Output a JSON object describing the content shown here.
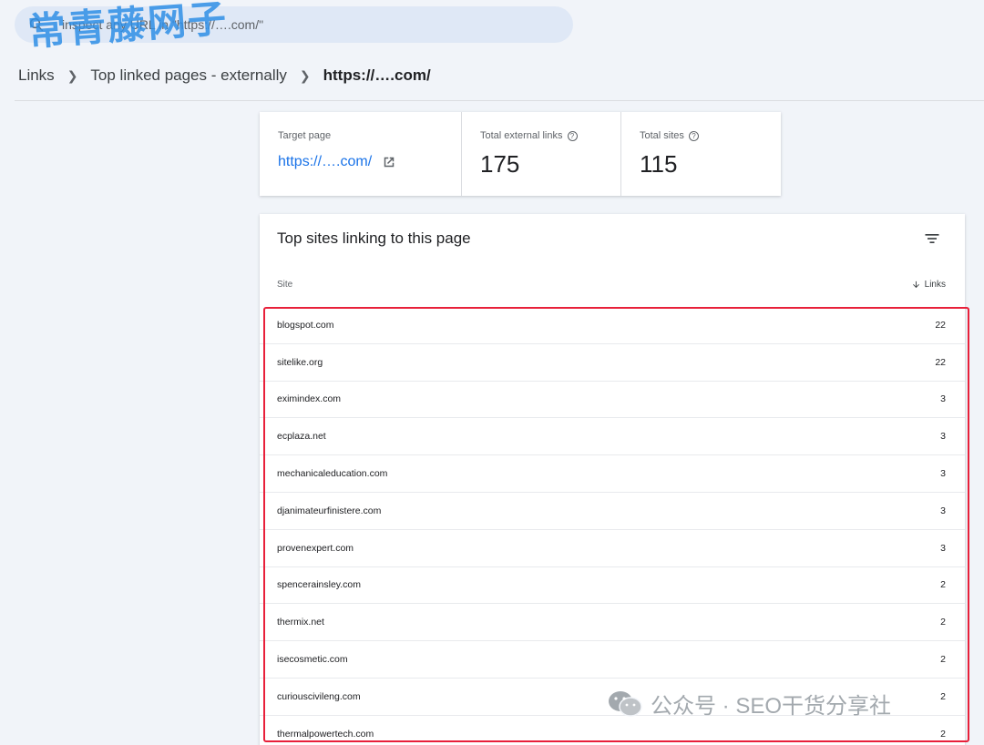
{
  "search": {
    "value": "inspect any URL in \"https://….com/\""
  },
  "watermark_top": "常青藤网子",
  "breadcrumb": {
    "items": [
      "Links",
      "Top linked pages - externally"
    ],
    "current": "https://….com/"
  },
  "stats": {
    "target": {
      "label": "Target page",
      "value": "https://….com/"
    },
    "external_links": {
      "label": "Total external links",
      "value": "175"
    },
    "sites": {
      "label": "Total sites",
      "value": "115"
    }
  },
  "table": {
    "title": "Top sites linking to this page",
    "col_site": "Site",
    "col_links": "Links",
    "rows": [
      {
        "site": "blogspot.com",
        "links": "22"
      },
      {
        "site": "sitelike.org",
        "links": "22"
      },
      {
        "site": "eximindex.com",
        "links": "3"
      },
      {
        "site": "ecplaza.net",
        "links": "3"
      },
      {
        "site": "mechanicaleducation.com",
        "links": "3"
      },
      {
        "site": "djanimateurfinistere.com",
        "links": "3"
      },
      {
        "site": "provenexpert.com",
        "links": "3"
      },
      {
        "site": "spencerainsley.com",
        "links": "2"
      },
      {
        "site": "thermix.net",
        "links": "2"
      },
      {
        "site": "isecosmetic.com",
        "links": "2"
      },
      {
        "site": "curiouscivileng.com",
        "links": "2"
      },
      {
        "site": "thermalpowertech.com",
        "links": "2"
      }
    ]
  },
  "watermark_bottom": "公众号 · SEO干货分享社",
  "colors": {
    "link": "#1a73e8",
    "highlight": "#e8203a",
    "background": "#f1f4f9"
  }
}
